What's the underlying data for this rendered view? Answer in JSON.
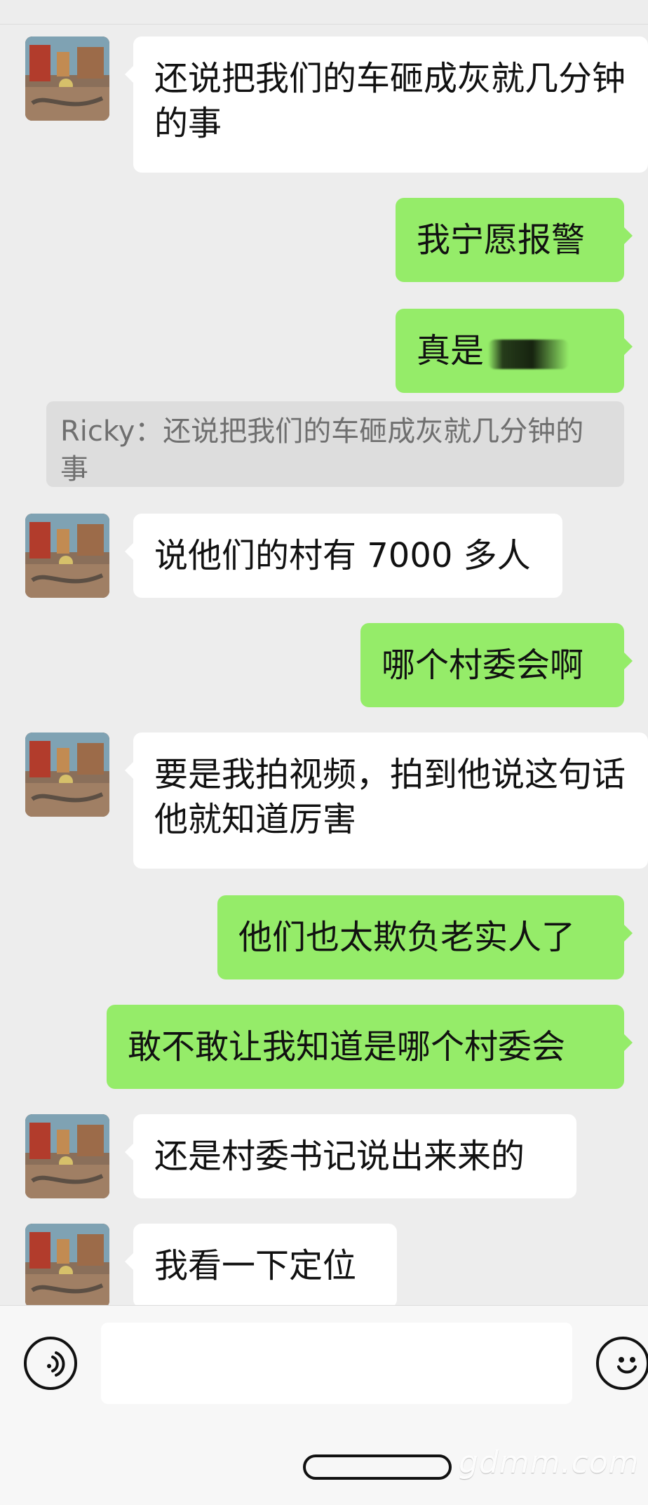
{
  "chat": {
    "messages": [
      {
        "text": "还说把我们的车砸成灰就几分钟的事"
      },
      {
        "text": "我宁愿报警"
      },
      {
        "text_prefix": "真是"
      },
      {
        "quote": "Ricky：还说把我们的车砸成灰就几分钟的事"
      },
      {
        "text": "说他们的村有 7000 多人"
      },
      {
        "text": "哪个村委会啊"
      },
      {
        "text": "要是我拍视频，拍到他说这句话他就知道厉害"
      },
      {
        "text": "他们也太欺负老实人了"
      },
      {
        "text": "敢不敢让我知道是哪个村委会"
      },
      {
        "text": "还是村委书记说出来来的"
      },
      {
        "text": "我看一下定位"
      }
    ]
  },
  "input": {
    "value": ""
  },
  "watermark": {
    "text": "gdmm.com"
  },
  "icons": {
    "voice": "voice-icon",
    "emoji": "emoji-icon",
    "avatar": "avatar-image"
  },
  "colors": {
    "background": "#ededed",
    "incoming_bubble": "#ffffff",
    "outgoing_bubble": "#95ec69",
    "quote_bg": "#dddddd"
  }
}
